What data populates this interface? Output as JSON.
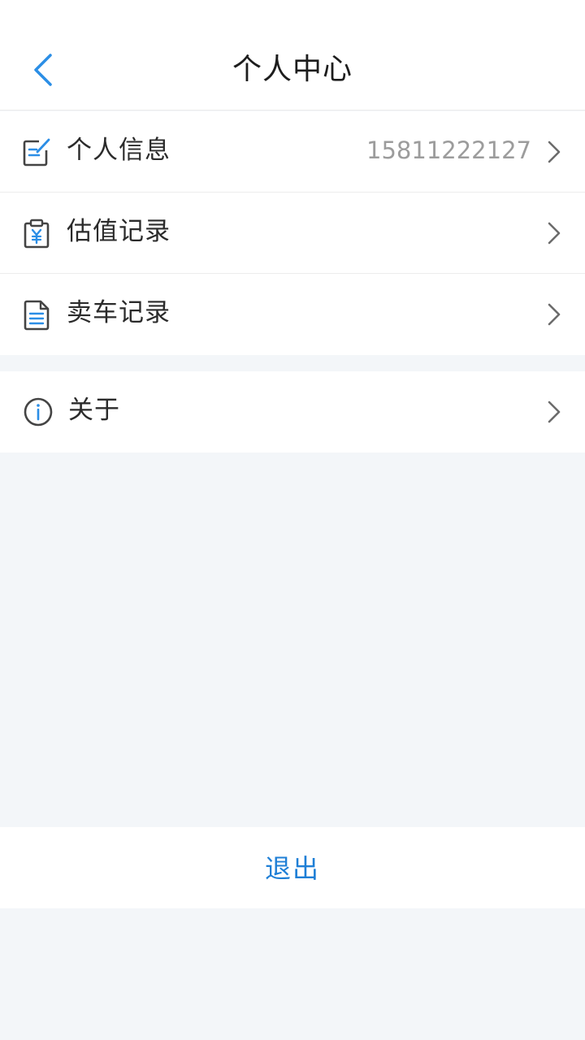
{
  "header": {
    "title": "个人中心",
    "back_icon": "chevron-left-icon"
  },
  "menu": [
    {
      "label": "个人信息",
      "value": "15811222127",
      "icon": "edit-document-icon"
    },
    {
      "label": "估值记录",
      "value": "",
      "icon": "clipboard-yen-icon"
    },
    {
      "label": "卖车记录",
      "value": "",
      "icon": "document-list-icon"
    }
  ],
  "about": {
    "label": "关于",
    "icon": "info-circle-icon"
  },
  "logout": {
    "label": "退出"
  },
  "colors": {
    "accent": "#1f7fd6",
    "background": "#f3f6f9",
    "text_primary": "#2b2b2b",
    "text_secondary": "#9c9c9c"
  }
}
